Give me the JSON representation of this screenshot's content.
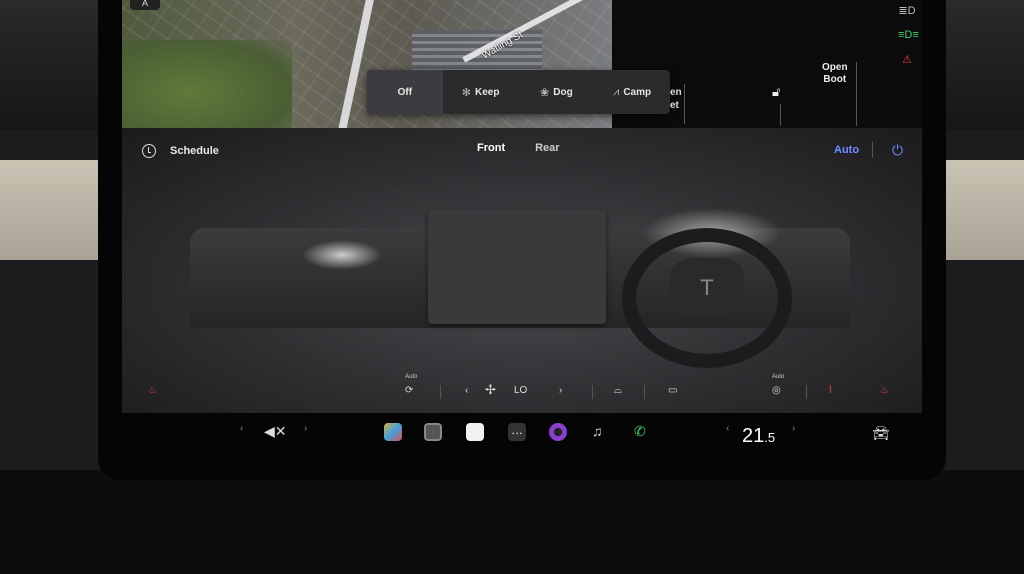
{
  "map": {
    "street_label": "Watling St",
    "compass": "A"
  },
  "modes": [
    {
      "label": "Off",
      "icon": "",
      "selected": true
    },
    {
      "label": "Keep",
      "icon": "fan-icon"
    },
    {
      "label": "Dog",
      "icon": "paw-icon"
    },
    {
      "label": "Camp",
      "icon": "tent-icon"
    }
  ],
  "partial_label_line1": "en",
  "partial_label_line2": "et",
  "boot": {
    "line1": "Open",
    "line2": "Boot"
  },
  "climate": {
    "schedule_label": "Schedule",
    "tab_front": "Front",
    "tab_rear": "Rear",
    "auto_label": "Auto",
    "fan_level": "LO",
    "recirc_auto_label": "Auto",
    "wheel_heat_auto_label": "Auto"
  },
  "taskbar": {
    "temperature_main": "21",
    "temperature_decimal": ".5"
  },
  "colors": {
    "accent": "#6f8cff",
    "alert": "#e04040",
    "headlight": "#3fd16b"
  }
}
